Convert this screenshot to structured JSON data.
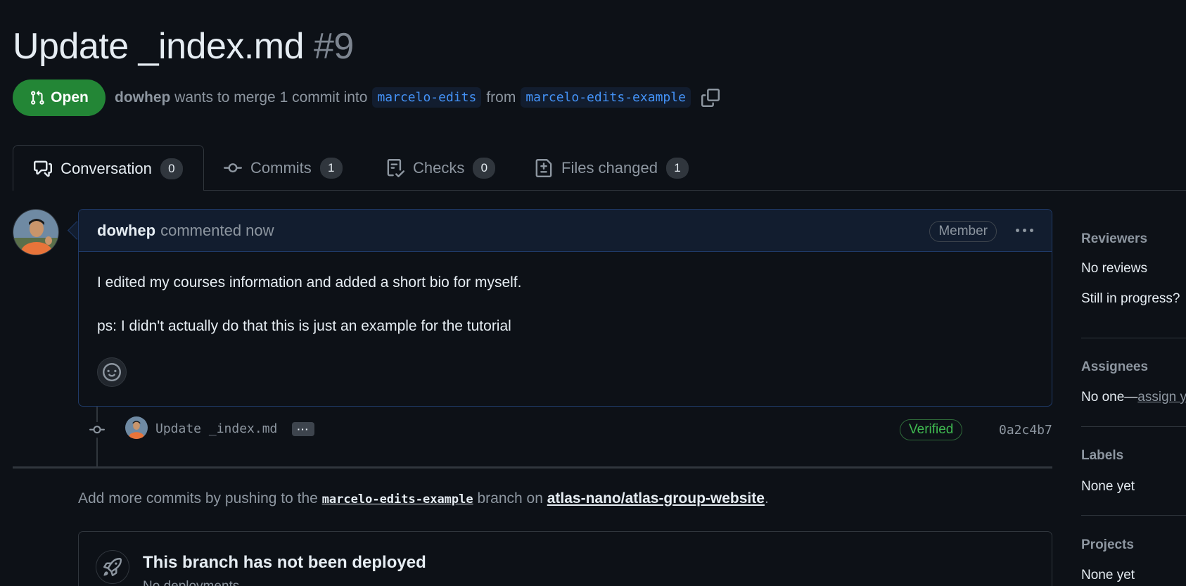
{
  "pr": {
    "title": "Update _index.md",
    "number": "#9",
    "state": "Open",
    "author": "dowhep",
    "merge_text_1": "wants to merge 1 commit into",
    "base_branch": "marcelo-edits",
    "from_text": "from",
    "head_branch": "marcelo-edits-example"
  },
  "tabs": [
    {
      "label": "Conversation",
      "count": "0",
      "icon": "comment-discussion-icon"
    },
    {
      "label": "Commits",
      "count": "1",
      "icon": "git-commit-icon"
    },
    {
      "label": "Checks",
      "count": "0",
      "icon": "checklist-icon"
    },
    {
      "label": "Files changed",
      "count": "1",
      "icon": "file-diff-icon"
    }
  ],
  "comment": {
    "author": "dowhep",
    "time": "commented now",
    "badge": "Member",
    "body_1": "I edited my courses information and added a short bio for myself.",
    "body_2": "ps: I didn't actually do that this is just an example for the tutorial"
  },
  "commit": {
    "message": "Update _index.md",
    "ellipsis": "···",
    "verified": "Verified",
    "sha": "0a2c4b7"
  },
  "add_commits": {
    "text_1": "Add more commits by pushing to the",
    "branch": "marcelo-edits-example",
    "text_2": "branch on",
    "repo": "atlas-nano/atlas-group-website",
    "end": "."
  },
  "deploy": {
    "title": "This branch has not been deployed",
    "subtitle": "No deployments"
  },
  "sidebar": {
    "reviewers_label": "Reviewers",
    "reviewers_value": "No reviews",
    "reviewers_extra": "Still in progress?",
    "assignees_label": "Assignees",
    "assignees_value": "No one—",
    "assignees_link": "assign y",
    "labels_label": "Labels",
    "labels_value": "None yet",
    "projects_label": "Projects",
    "projects_value": "None yet"
  },
  "colors": {
    "open_green": "#238636",
    "link_blue": "#4493f8",
    "verified_green": "#3fb950",
    "background": "#0d1117"
  }
}
